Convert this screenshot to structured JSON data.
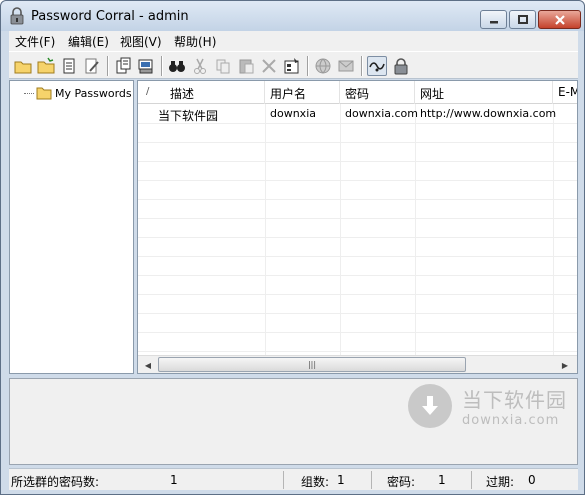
{
  "window": {
    "title": "Password Corral - admin",
    "min_icon": "minimize-icon",
    "max_icon": "maximize-icon",
    "close_icon": "close-icon"
  },
  "menu": [
    {
      "label": "文件(F)"
    },
    {
      "label": "编辑(E)"
    },
    {
      "label": "视图(V)"
    },
    {
      "label": "帮助(H)"
    }
  ],
  "toolbar": [
    {
      "icon": "new-folder-icon"
    },
    {
      "icon": "open-folder-icon"
    },
    {
      "icon": "properties-icon"
    },
    {
      "icon": "edit-icon"
    },
    {
      "icon": "copy-clipboard-icon"
    },
    {
      "icon": "print-icon"
    },
    {
      "icon": "find-binoculars-icon"
    },
    {
      "icon": "cut-icon"
    },
    {
      "icon": "copy-icon"
    },
    {
      "icon": "paste-icon"
    },
    {
      "icon": "delete-icon"
    },
    {
      "icon": "properties-sheet-icon"
    },
    {
      "icon": "globe-icon"
    },
    {
      "icon": "email-icon"
    },
    {
      "icon": "auto-type-icon"
    },
    {
      "icon": "lock-icon"
    }
  ],
  "tree": {
    "root_label": "My Passwords",
    "folder_icon": "folder-icon"
  },
  "list": {
    "sort_indicator": "/",
    "columns": [
      "描述",
      "用户名",
      "密码",
      "网址",
      "E-M"
    ],
    "rows": [
      {
        "desc": "当下软件园",
        "user": "downxia",
        "password": "downxia.com",
        "url": "http://www.downxia.com",
        "email": ""
      }
    ],
    "scroll_thumb_grip": "|||"
  },
  "watermark": {
    "title": "当下软件园",
    "url": "downxia.com"
  },
  "status": {
    "selected_label": "所选群的密码数:",
    "selected_value": "1",
    "groups_label": "组数:",
    "groups_value": "1",
    "passwords_label": "密码:",
    "passwords_value": "1",
    "expired_label": "过期:",
    "expired_value": "0"
  }
}
